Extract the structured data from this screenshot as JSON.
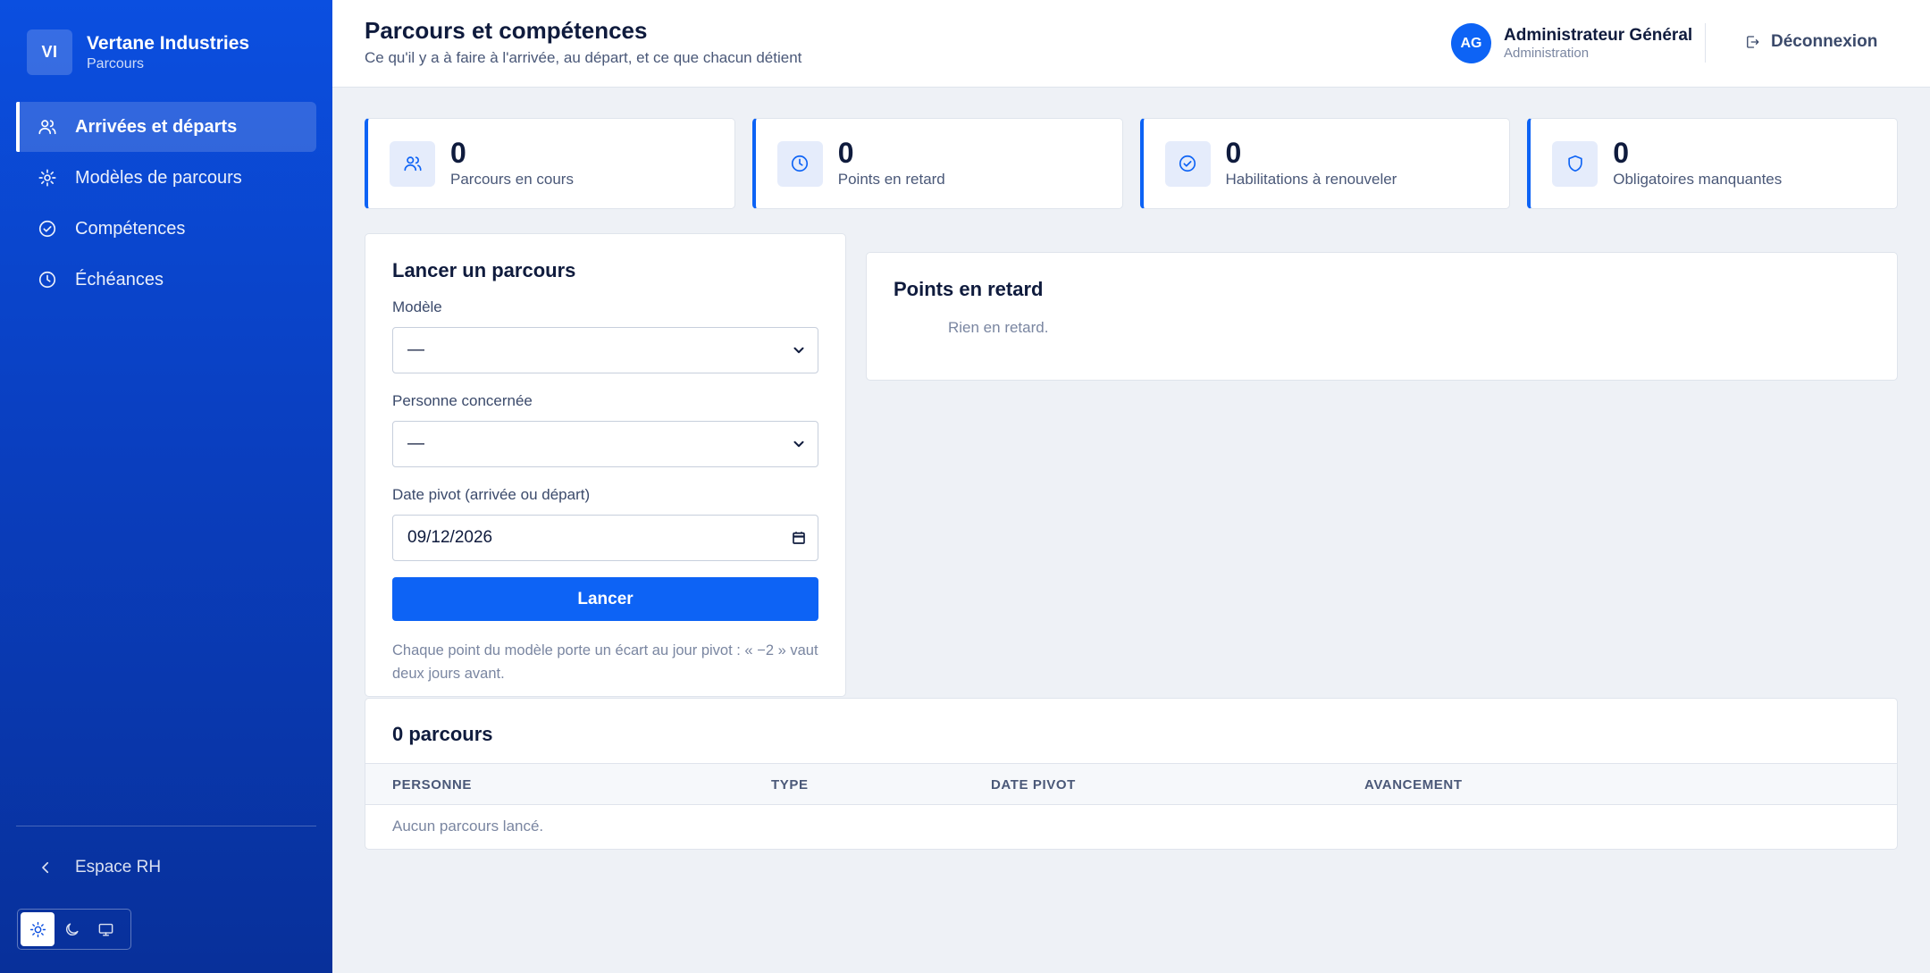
{
  "brand": {
    "initials": "VI",
    "name": "Vertane Industries",
    "sub": "Parcours"
  },
  "nav": {
    "items": [
      {
        "label": "Arrivées et départs",
        "icon": "users-icon",
        "active": true
      },
      {
        "label": "Modèles de parcours",
        "icon": "gear-icon",
        "active": false
      },
      {
        "label": "Compétences",
        "icon": "check-circle-icon",
        "active": false
      },
      {
        "label": "Échéances",
        "icon": "clock-icon",
        "active": false
      }
    ],
    "back_label": "Espace RH"
  },
  "theme": {
    "options": [
      "light",
      "dark",
      "system"
    ],
    "selected": "light"
  },
  "header": {
    "title": "Parcours et compétences",
    "subtitle": "Ce qu'il y a à faire à l'arrivée, au départ, et ce que chacun détient",
    "user": {
      "initials": "AG",
      "name": "Administrateur Général",
      "role": "Administration"
    },
    "logout_label": "Déconnexion"
  },
  "stats": [
    {
      "value": "0",
      "label": "Parcours en cours",
      "icon": "users-icon"
    },
    {
      "value": "0",
      "label": "Points en retard",
      "icon": "clock-icon"
    },
    {
      "value": "0",
      "label": "Habilitations à renouveler",
      "icon": "check-circle-icon"
    },
    {
      "value": "0",
      "label": "Obligatoires manquantes",
      "icon": "shield-icon"
    }
  ],
  "launch": {
    "title": "Lancer un parcours",
    "model_label": "Modèle",
    "model_value": "—",
    "person_label": "Personne concernée",
    "person_value": "—",
    "date_label": "Date pivot (arrivée ou départ)",
    "date_value": "09/12/2026",
    "button_label": "Lancer",
    "help": "Chaque point du modèle porte un écart au jour pivot : « −2 » vaut deux jours avant."
  },
  "late": {
    "title": "Points en retard",
    "empty": "Rien en retard."
  },
  "table": {
    "title": "0 parcours",
    "columns": [
      "PERSONNE",
      "TYPE",
      "DATE PIVOT",
      "AVANCEMENT"
    ],
    "empty": "Aucun parcours lancé."
  },
  "colors": {
    "accent": "#0d63f5",
    "sidebar": "#0b4fe0",
    "background": "#eef1f6"
  }
}
